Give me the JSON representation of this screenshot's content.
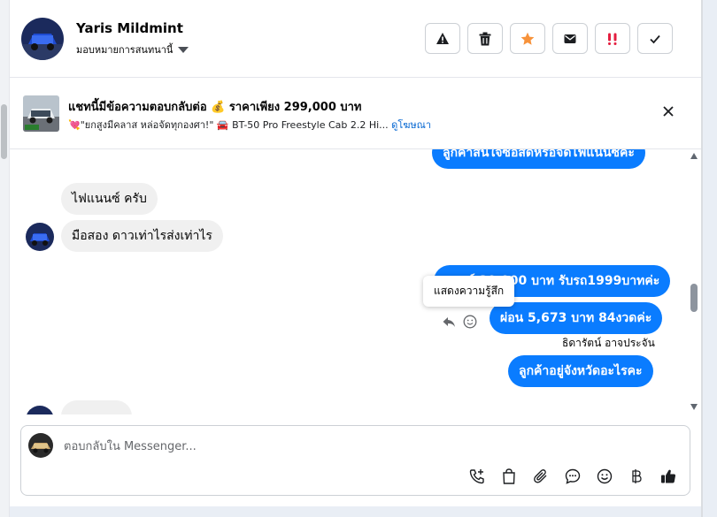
{
  "header": {
    "contact_name": "Yaris Mildmint",
    "assign_label": "มอบหมายการสนทนานี้",
    "actions": [
      {
        "icon": "warning-icon",
        "label": "Mark as spam"
      },
      {
        "icon": "trash-icon",
        "label": "Delete"
      },
      {
        "icon": "star-icon",
        "label": "Follow up"
      },
      {
        "icon": "envelope-icon",
        "label": "Mark as unread"
      },
      {
        "icon": "priority-icon",
        "label": "Priority"
      },
      {
        "icon": "check-icon",
        "label": "Done"
      }
    ]
  },
  "ad": {
    "title": "แชทนี้มีข้อความตอบกลับต่อ 💰 ราคาเพียง 299,000 บาท",
    "subtitle": "💘\"ยกสูงมีคลาส หล่อจัดทุกองศา!\" 🚘 BT-50 Pro Freestyle Cab 2.2 Hi...",
    "link": "ดูโฆษณา"
  },
  "thread": {
    "messages": [
      {
        "dir": "out",
        "text": "ลูกค้าสนใจซื้อสดหรือจัดไฟแนนซ์คะ"
      },
      {
        "dir": "in",
        "text": "ไฟแนนซ์ ครับ"
      },
      {
        "dir": "in",
        "text": "มือสอง ดาวเท่าไรส่งเท่าไร"
      },
      {
        "dir": "out",
        "text": "ดาวน์ 29,900 บาท รับรถ1999บาทค่ะ"
      },
      {
        "dir": "out",
        "text": "ผ่อน 5,673 บาท 84งวดค่ะ"
      },
      {
        "dir": "out",
        "text": "ลูกค้าอยู่จังหวัดอะไรคะ"
      }
    ],
    "tooltip": "แสดงความรู้สึก",
    "sender": "ธิดารัตน์ อาจประจัน"
  },
  "composer": {
    "placeholder": "ตอบกลับใน Messenger..."
  },
  "colors": {
    "accent": "#0a7cff",
    "star": "#f7923a",
    "priority": "#e41e3f"
  }
}
